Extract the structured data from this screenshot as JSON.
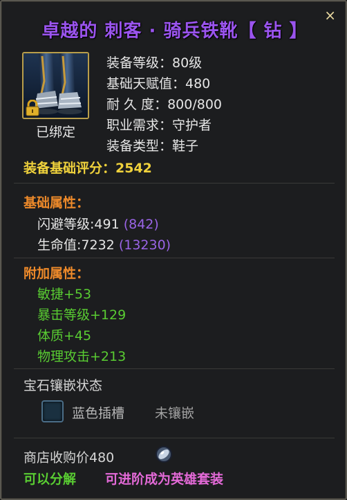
{
  "item": {
    "title": "卓越的 刺客 · 骑兵铁靴【 钻 】",
    "close": "×",
    "bound": "已绑定",
    "stats": [
      "装备等级：80级",
      "基础天赋值：480",
      "耐 久 度：800/800",
      "职业需求：守护者",
      "装备类型：鞋子"
    ],
    "score": "装备基础评分：2542",
    "base_section": "基础属性：",
    "base_attrs": [
      {
        "text": "闪避等级:491",
        "bonus": "(842)"
      },
      {
        "text": "生命值:7232",
        "bonus": "(13230)"
      }
    ],
    "extra_section": "附加属性：",
    "extra_attrs": [
      "敏捷+53",
      "暴击等级+129",
      "体质+45",
      "物理攻击+213"
    ],
    "gem_title": "宝石镶嵌状态",
    "socket_label": "蓝色插槽",
    "socket_state": "未镶嵌",
    "price": "商店收购价480",
    "decompose": "可以分解",
    "upgrade": "可进阶成为英雄套装"
  },
  "icons": {
    "item": "iron-boots-icon",
    "lock": "padlock-icon",
    "socket": "blue-socket-icon",
    "currency": "silver-coin-icon",
    "close": "close-icon"
  },
  "colors": {
    "title": "#9a54ee",
    "score": "#f0d23c",
    "section": "#ee8a2a",
    "bonus": "#9a64e6",
    "green": "#59cc32",
    "upgrade": "#e46ad8"
  }
}
